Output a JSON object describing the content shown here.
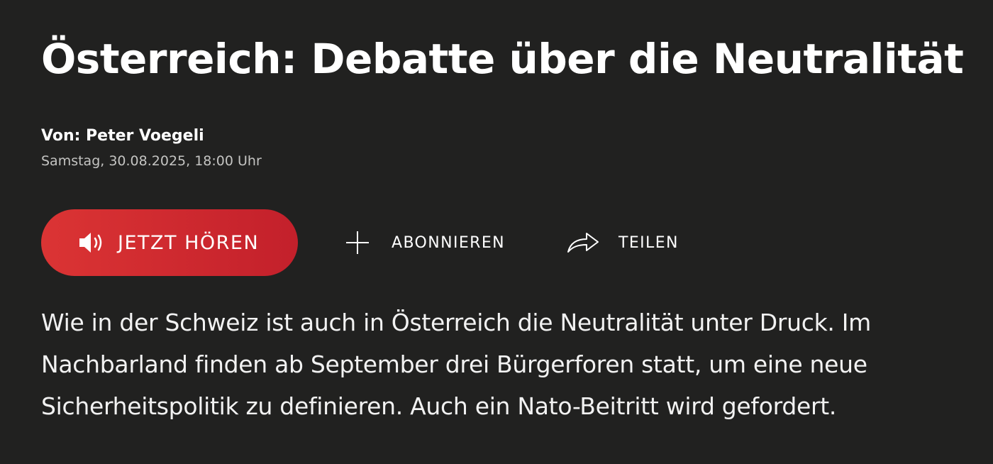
{
  "article": {
    "title": "Österreich: Debatte über die Neutralität",
    "author": "Von: Peter Voegeli",
    "date": "Samstag, 30.08.2025, 18:00 Uhr",
    "lead": "Wie in der Schweiz ist auch in Österreich die Neutralität unter Druck. Im Nachbarland finden ab September drei Bürgerforen statt, um eine neue Sicherheitspolitik zu definieren. Auch ein Nato-Beitritt wird gefordert."
  },
  "actions": {
    "listen_label": "JETZT HÖREN",
    "listen_icon": "speaker-icon",
    "subscribe_label": "ABONNIEREN",
    "subscribe_icon": "plus-icon",
    "share_label": "TEILEN",
    "share_icon": "share-arrow-icon"
  },
  "colors": {
    "background": "#212120",
    "accent_red": "#d22b31",
    "text": "#ffffff",
    "muted_text": "#c4c4c2"
  }
}
